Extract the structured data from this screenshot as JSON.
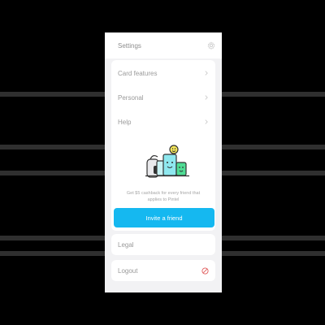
{
  "header": {
    "title": "Settings",
    "icon": "gear-icon"
  },
  "menu": {
    "items": [
      {
        "label": "Card features",
        "icon": "chevron-right-icon"
      },
      {
        "label": "Personal",
        "icon": "chevron-right-icon"
      },
      {
        "label": "Help",
        "icon": "chevron-right-icon"
      }
    ]
  },
  "invite": {
    "text": "Get $5 cashback for every friend that applies to Pintel",
    "button_label": "Invite a friend",
    "illustration": "friends-illustration-icon"
  },
  "legal": {
    "label": "Legal"
  },
  "logout": {
    "label": "Logout",
    "icon": "logout-icon"
  },
  "colors": {
    "accent": "#15b8f0",
    "logout_red": "#e05a5a",
    "background": "#f2f2f4"
  }
}
